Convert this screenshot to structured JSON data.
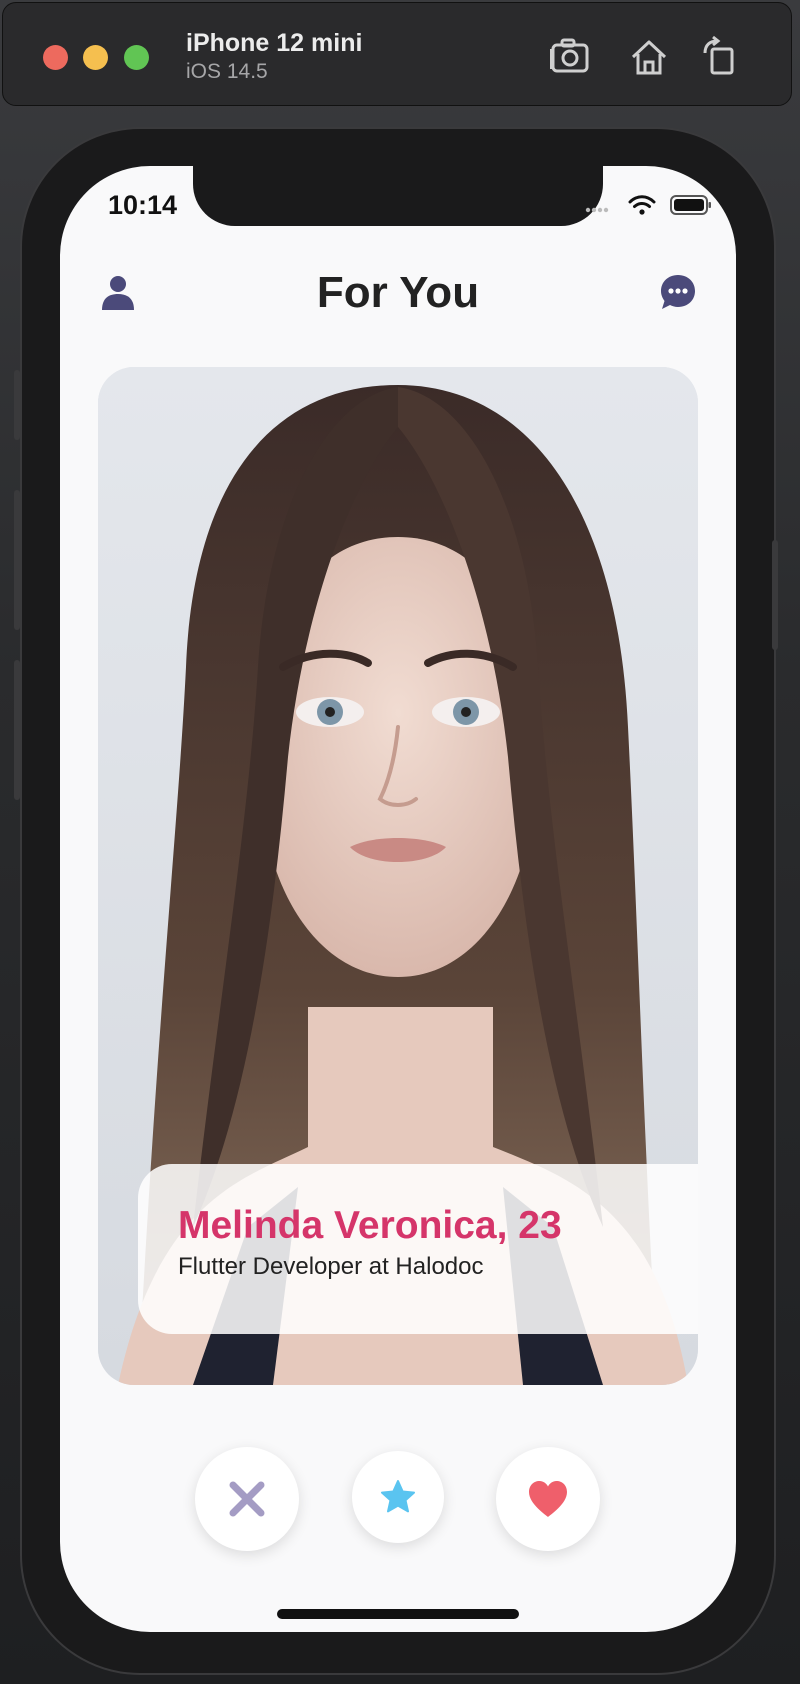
{
  "simulator": {
    "device_name": "iPhone 12 mini",
    "os_version": "iOS 14.5",
    "icons": [
      "screenshot-icon",
      "home-icon",
      "rotate-icon"
    ]
  },
  "status_bar": {
    "time": "10:14"
  },
  "header": {
    "title": "For You",
    "left_icon": "profile-icon",
    "right_icon": "chat-icon"
  },
  "card": {
    "name_age": "Melinda Veronica, 23",
    "job": "Flutter Developer at Halodoc"
  },
  "actions": {
    "nope_icon": "close-icon",
    "superlike_icon": "star-icon",
    "like_icon": "heart-icon"
  },
  "colors": {
    "name_accent": "#d5356a",
    "nope": "#a49cc4",
    "star": "#5ac4f0",
    "heart": "#ef5f6b",
    "header_icons": "#4b4a7a"
  }
}
